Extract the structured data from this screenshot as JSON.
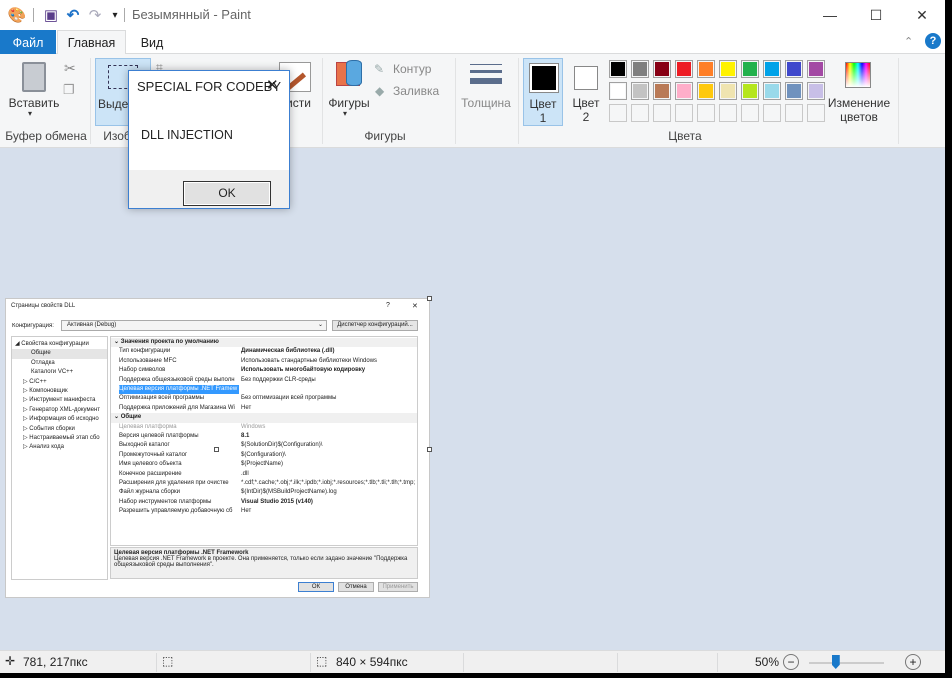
{
  "window": {
    "title": "Безымянный - Paint",
    "minimize": "—",
    "maximize": "☐",
    "close": "✕"
  },
  "qat": {
    "app_icon": "paint-palette-icon",
    "save": "save-icon",
    "undo": "undo-icon",
    "redo": "redo-icon",
    "customize": "▾"
  },
  "tabs": [
    {
      "label": "Файл"
    },
    {
      "label": "Главная"
    },
    {
      "label": "Вид"
    }
  ],
  "ribbon": {
    "clipboard": {
      "paste": "Вставить",
      "group": "Буфер обмена"
    },
    "image": {
      "select": "Выделить",
      "group": "Изображение"
    },
    "brushes": {
      "label": "Кисти"
    },
    "shapes": {
      "shapes": "Фигуры",
      "outline": "Контур",
      "fill": "Заливка",
      "group": "Фигуры"
    },
    "size": {
      "label": "Толщина"
    },
    "colors": {
      "color1": "Цвет 1",
      "color1_a": "Цвет",
      "color1_b": "1",
      "color2_a": "Цвет",
      "color2_b": "2",
      "edit_a": "Изменение",
      "edit_b": "цветов",
      "group": "Цвета",
      "color1_value": "#000000",
      "color2_value": "#ffffff",
      "palette": [
        "#000000",
        "#7f7f7f",
        "#880015",
        "#ed1c24",
        "#ff7f27",
        "#fff200",
        "#22b14c",
        "#00a2e8",
        "#3f48cc",
        "#a349a4",
        "#ffffff",
        "#c3c3c3",
        "#b97a57",
        "#ffaec9",
        "#ffc90e",
        "#efe4b0",
        "#b5e61d",
        "#99d9ea",
        "#7092be",
        "#c8bfe7"
      ]
    }
  },
  "embedded": {
    "title": "Страницы свойств DLL",
    "help": "?",
    "close": "✕",
    "config_label": "Конфигурация:",
    "config_value": "Активная (Debug)",
    "config_manager": "Диспетчер конфигураций...",
    "tree": [
      {
        "label": "◢ Свойства конфигурации",
        "indent": 0
      },
      {
        "label": "Общие",
        "indent": 2,
        "selected": true
      },
      {
        "label": "Отладка",
        "indent": 2
      },
      {
        "label": "Каталоги VC++",
        "indent": 2
      },
      {
        "label": "▷ C/C++",
        "indent": 1
      },
      {
        "label": "▷ Компоновщик",
        "indent": 1
      },
      {
        "label": "▷ Инструмент манифеста",
        "indent": 1
      },
      {
        "label": "▷ Генератор XML-документ",
        "indent": 1
      },
      {
        "label": "▷ Информация об исходно",
        "indent": 1
      },
      {
        "label": "▷ События сборки",
        "indent": 1
      },
      {
        "label": "▷ Настраиваемый этап сбо",
        "indent": 1
      },
      {
        "label": "▷ Анализ кода",
        "indent": 1
      }
    ],
    "grid": [
      {
        "header": "Значения проекта по умолчанию"
      },
      {
        "k": "Тип конфигурации",
        "v": "Динамическая библиотека (.dll)",
        "bold": true
      },
      {
        "k": "Использование MFC",
        "v": "Использовать стандартные библиотеки Windows"
      },
      {
        "k": "Набор символов",
        "v": "Использовать многобайтовую кодировку",
        "bold": true
      },
      {
        "k": "Поддержка общеязыковой среды выполн",
        "v": "Без поддержки CLR-среды"
      },
      {
        "k": "Целевая версия платформы .NET Framew",
        "v": "",
        "selected": true
      },
      {
        "k": "Оптимизация всей программы",
        "v": "Без оптимизации всей программы"
      },
      {
        "k": "Поддержка приложений для Магазина Wi",
        "v": "Нет"
      },
      {
        "header": "Общие"
      },
      {
        "k": "Целевая платформа",
        "v": "Windows",
        "gray": true
      },
      {
        "k": "Версия целевой платформы",
        "v": "8.1",
        "bold": true
      },
      {
        "k": "Выходной каталог",
        "v": "$(SolutionDir)$(Configuration)\\"
      },
      {
        "k": "Промежуточный каталог",
        "v": "$(Configuration)\\"
      },
      {
        "k": "Имя целевого объекта",
        "v": "$(ProjectName)"
      },
      {
        "k": "Конечное расширение",
        "v": ".dll"
      },
      {
        "k": "Расширения для удаления при очистке",
        "v": "*.cdf;*.cache;*.obj;*.ilk;*.ipdb;*.iobj;*.resources;*.tlb;*.tli;*.tlh;*.tmp;"
      },
      {
        "k": "Файл журнала сборки",
        "v": "$(IntDir)$(MSBuildProjectName).log"
      },
      {
        "k": "Набор инструментов платформы",
        "v": "Visual Studio 2015 (v140)",
        "bold": true
      },
      {
        "k": "Разрешить управляемую добавочную сб",
        "v": "Нет"
      }
    ],
    "desc_title": "Целевая версия платформы .NET Framework",
    "desc_text": "Целевая версия .NET Framework в проекте. Она применяется, только если задано значение \"Поддержка общеязыковой среды выполнения\".",
    "ok": "ОК",
    "cancel": "Отмена",
    "apply": "Применить"
  },
  "msgbox": {
    "title": "SPECIAL FOR CODEBY",
    "close": "✕",
    "text": "DLL INJECTION",
    "ok": "OK"
  },
  "status": {
    "cursor_pos": "781, 217пкс",
    "selection_size": "",
    "image_size": "840 × 594пкс",
    "zoom": "50%",
    "zoom_value": 50
  }
}
